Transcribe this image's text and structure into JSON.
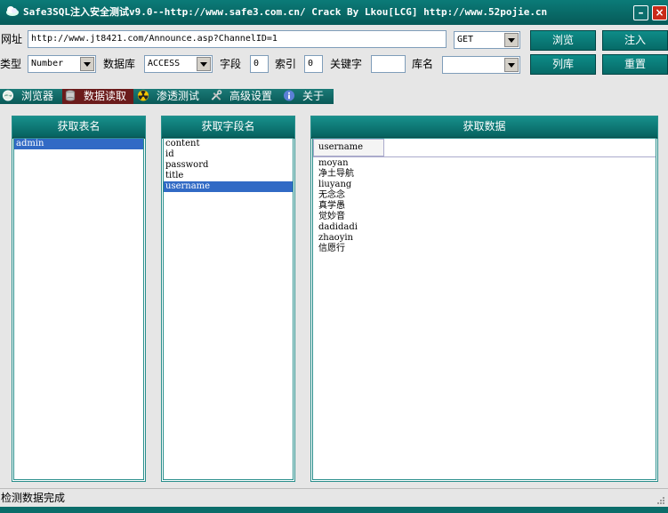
{
  "window": {
    "title": "Safe3SQL注入安全测试v9.0--http://www.safe3.com.cn/  Crack By Lkou[LCG]  http://www.52pojie.cn",
    "min_label": "–",
    "close_label": "×"
  },
  "toolbar": {
    "url_label": "网址",
    "url_value": "http://www.jt8421.com/Announce.asp?ChannelID=1",
    "method_value": "GET",
    "browse_label": "浏览",
    "inject_label": "注入",
    "type_label": "类型",
    "type_value": "Number",
    "db_label": "数据库",
    "db_value": "ACCESS",
    "field_label": "字段",
    "field_value": "0",
    "index_label": "索引",
    "index_value": "0",
    "keyword_label": "关键字",
    "keyword_value": "",
    "dbname_label": "库名",
    "dbname_value": "",
    "listdb_label": "列库",
    "reset_label": "重置"
  },
  "tabs": [
    {
      "label": "浏览器",
      "icon": "globe-icon"
    },
    {
      "label": "数据读取",
      "icon": "database-icon",
      "active": true
    },
    {
      "label": "渗透测试",
      "icon": "radiation-icon"
    },
    {
      "label": "高级设置",
      "icon": "tools-icon"
    },
    {
      "label": "关于",
      "icon": "info-icon"
    }
  ],
  "panels": {
    "tables": {
      "title": "获取表名",
      "items": [
        {
          "label": "admin",
          "selected": true
        }
      ]
    },
    "fields": {
      "title": "获取字段名",
      "items": [
        {
          "label": "content"
        },
        {
          "label": "id"
        },
        {
          "label": "password"
        },
        {
          "label": "title"
        },
        {
          "label": "username",
          "selected": true
        }
      ]
    },
    "data": {
      "title": "获取数据",
      "column": "username",
      "rows": [
        "moyan",
        "净土导航",
        "liuyang",
        "无念念",
        "真学愚",
        "觉妙音",
        "dadidadi",
        "zhaoyin",
        "信愿行"
      ]
    }
  },
  "status": {
    "text": "检测数据完成"
  },
  "colors": {
    "accent": "#0b7b78",
    "selection": "#316ac5",
    "active_tab": "#6b1b1b"
  }
}
